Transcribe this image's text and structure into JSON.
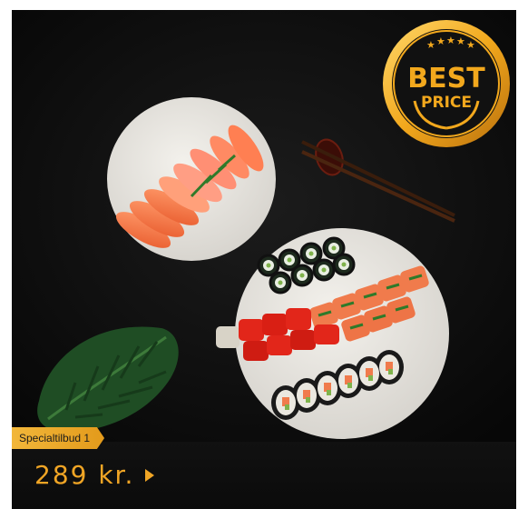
{
  "badge": {
    "line1": "BEST",
    "line2": "PRICE"
  },
  "offer": {
    "tag": "Specialtilbud 1",
    "price": "289 kr."
  },
  "colors": {
    "accent": "#f0a525",
    "background": "#0c0c0c"
  }
}
